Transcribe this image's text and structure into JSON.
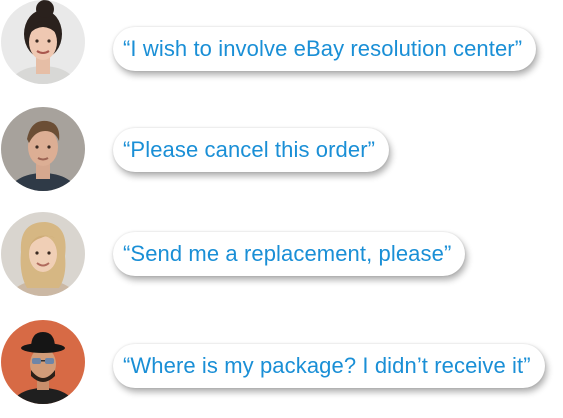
{
  "messages": [
    {
      "avatar": "woman-dark-hair-avatar",
      "text": "“I wish to involve eBay resolution center”"
    },
    {
      "avatar": "man-brown-hair-avatar",
      "text": "“Please cancel this order”"
    },
    {
      "avatar": "woman-blonde-hair-avatar",
      "text": "“Send me a replacement, please”"
    },
    {
      "avatar": "man-hat-sunglasses-avatar",
      "text": "“Where is my package? I didn’t receive it”"
    }
  ],
  "colors": {
    "text": "#1a8fd6",
    "bubble_bg": "#ffffff"
  }
}
